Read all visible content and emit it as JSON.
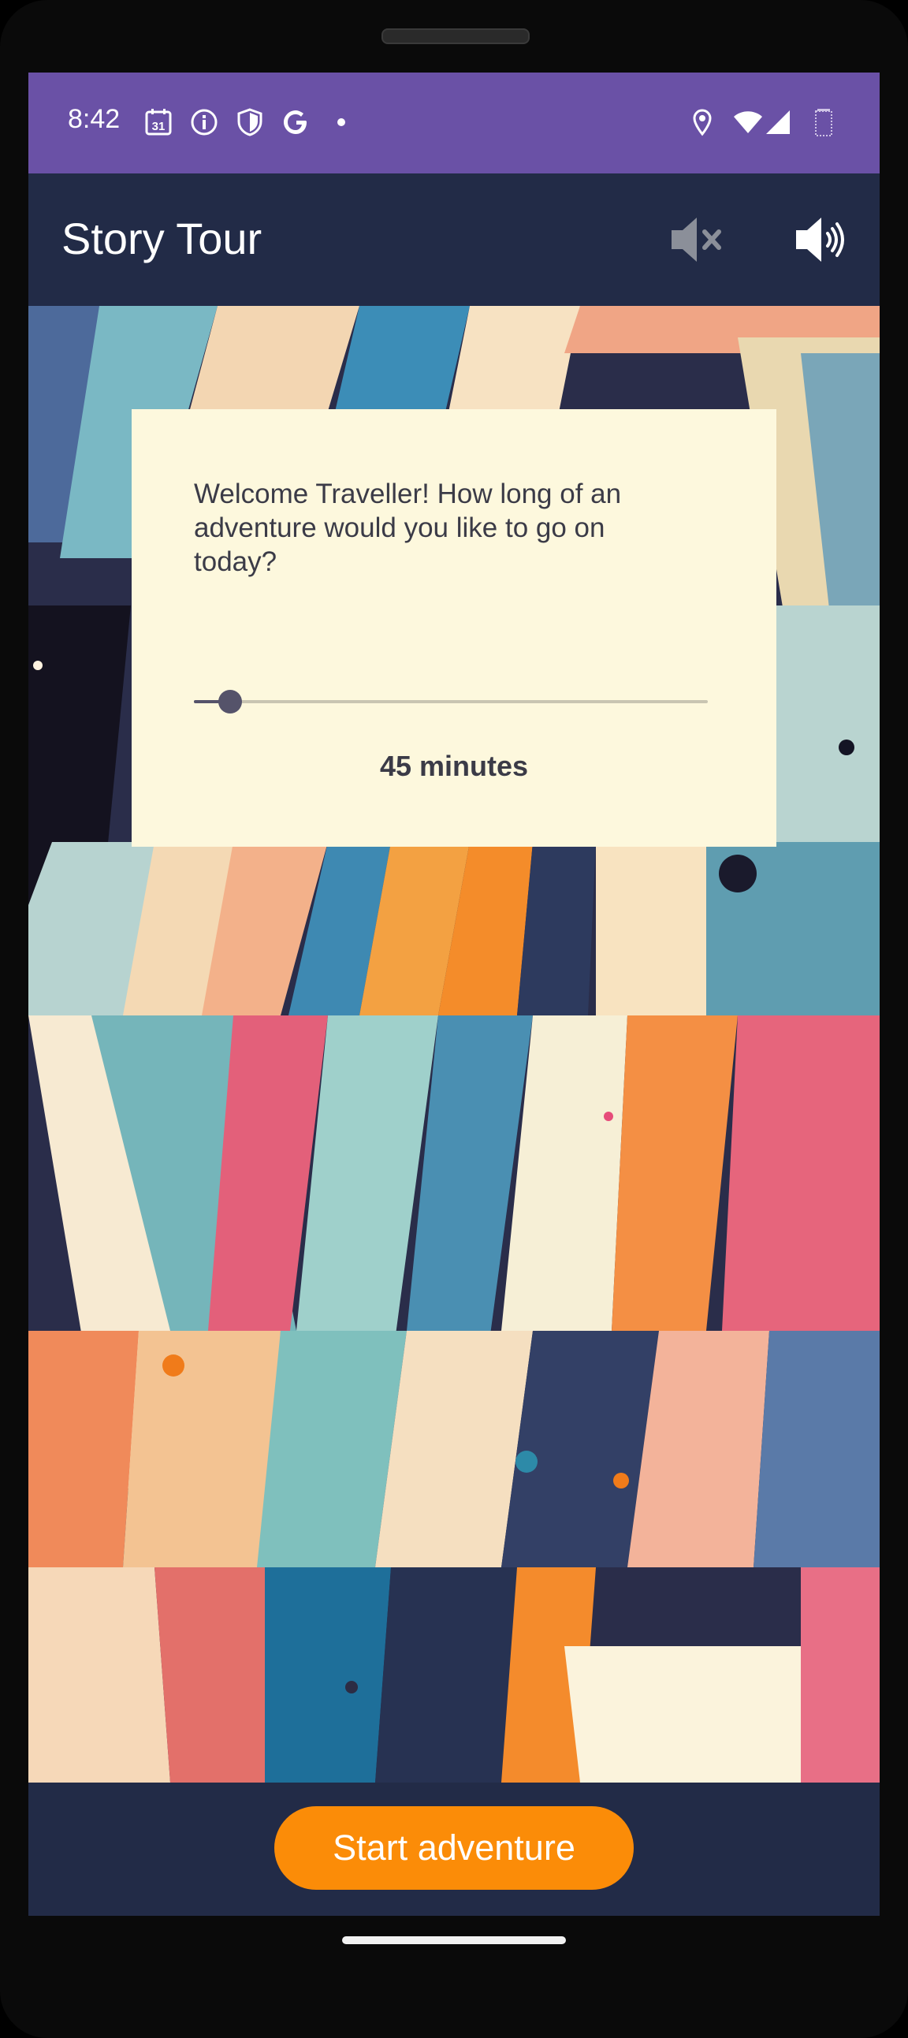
{
  "status_bar": {
    "time": "8:42",
    "calendar_day": "31",
    "icons": [
      "calendar-icon",
      "info-icon",
      "shield-icon",
      "google-icon",
      "dot-icon",
      "location-icon",
      "wifi-icon",
      "signal-icon",
      "battery-icon"
    ],
    "background_color": "#6a51a6"
  },
  "app_bar": {
    "title": "Story Tour",
    "mute_icon": "volume-mute-icon",
    "sound_icon": "volume-up-icon",
    "background_color": "#222b47"
  },
  "dialog": {
    "prompt": "Welcome Traveller! How long of an adventure would you like to go on today?",
    "slider_fraction": 0.07,
    "duration_label": "45 minutes",
    "background_color": "#fdf8dd"
  },
  "footer": {
    "start_button": "Start adventure",
    "button_color": "#fb8c08"
  }
}
